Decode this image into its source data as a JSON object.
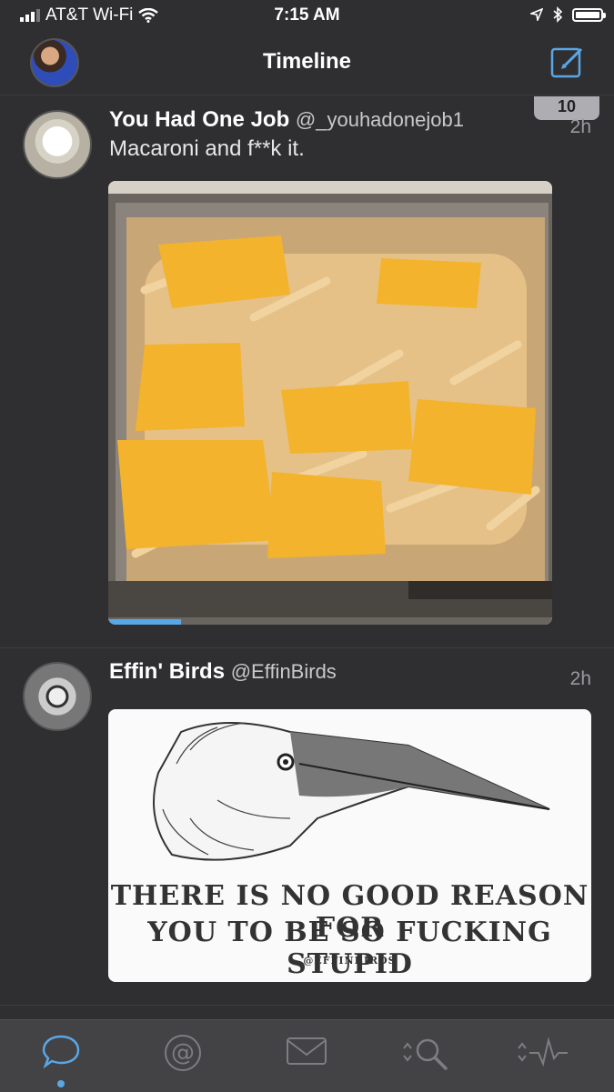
{
  "status_bar": {
    "carrier": "AT&T Wi-Fi",
    "time": "7:15 AM"
  },
  "nav": {
    "title": "Timeline",
    "compose_icon": "compose-icon"
  },
  "tweets": [
    {
      "name": "You Had One Job",
      "handle": "@_youhadonejob1",
      "time": "2h",
      "text": "Macaroni and f**k it.",
      "unread_count": "10",
      "media": "photo of penne pasta with cheese slices in a tray"
    },
    {
      "name": "Effin' Birds",
      "handle": "@EffinBirds",
      "time": "2h",
      "media_caption_line1": "THERE IS NO GOOD REASON FOR",
      "media_caption_line2": "YOU TO BE SO FUCKING STUPID",
      "media_credit": "@EFFINBIRDS"
    }
  ],
  "tab_bar": {
    "tabs": [
      {
        "icon": "speech-bubble-icon",
        "active": true
      },
      {
        "icon": "at-sign-icon",
        "active": false
      },
      {
        "icon": "envelope-icon",
        "active": false
      },
      {
        "icon": "search-icon",
        "active": false
      },
      {
        "icon": "activity-icon",
        "active": false
      }
    ],
    "accent": "#5aa7e6"
  }
}
